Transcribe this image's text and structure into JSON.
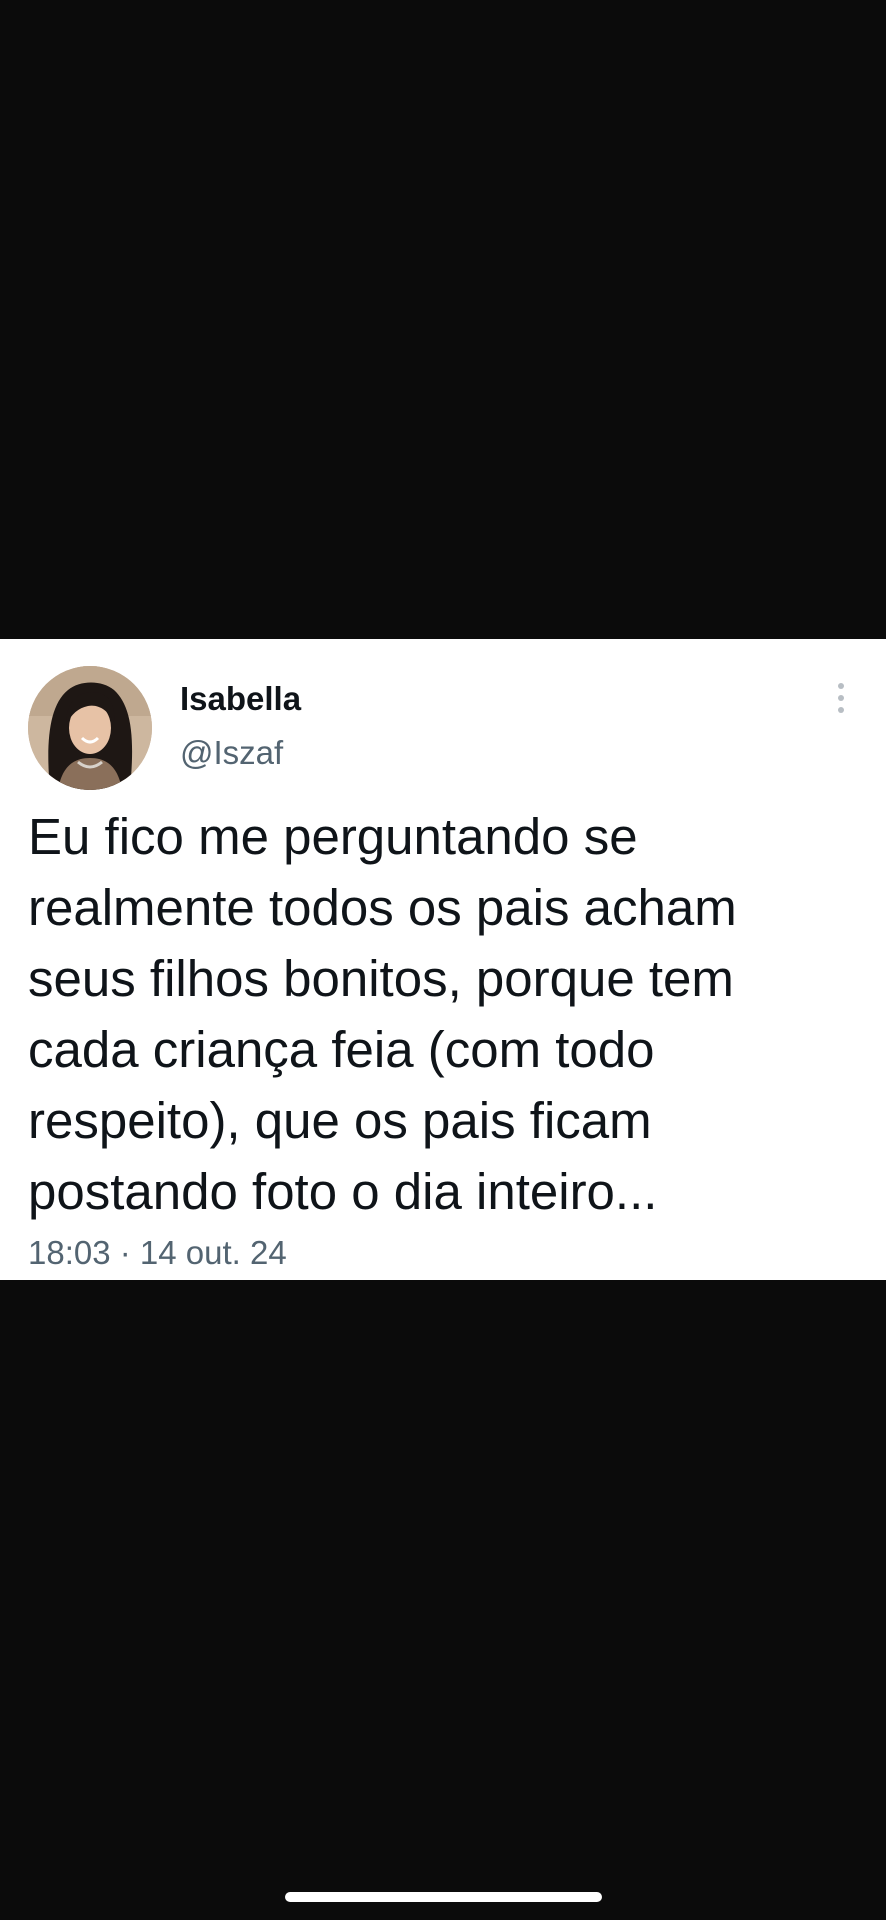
{
  "tweet": {
    "display_name": "Isabella",
    "handle": "@Iszaf",
    "text": "Eu fico me perguntando se\nrealmente todos os pais acham\nseus filhos bonitos, porque tem\ncada criança feia (com todo\nrespeito), que os pais ficam\npostando foto o dia inteiro...",
    "timestamp": "18:03 · 14 out. 24",
    "more_icon": "more-vertical-icon"
  },
  "colors": {
    "background": "#0b0b0b",
    "card": "#ffffff",
    "primary_text": "#0f1419",
    "secondary_text": "#536471"
  }
}
